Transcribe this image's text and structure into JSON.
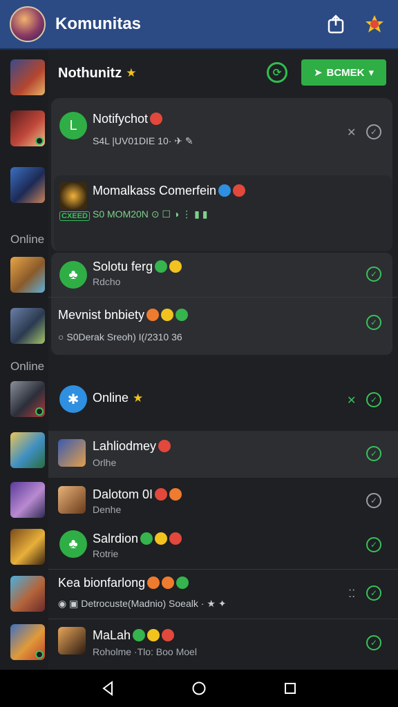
{
  "header": {
    "title": "Komunitas"
  },
  "topbar": {
    "title": "Nothunitz",
    "button_label": "BCMEK"
  },
  "rail_labels": [
    "Online",
    "Online"
  ],
  "rows": [
    {
      "title": "Notifychot",
      "meta": "S4L |UV01DIE  10·"
    },
    {
      "title": "Momalkass Comerfein",
      "badge": "CXEED",
      "meta": "S0 MOM20N"
    },
    {
      "title": "Solotu ferg",
      "sub": "Rdcho"
    },
    {
      "title": "Mevnist bnbiety",
      "meta": "S0Derak Sreoh)  I(/2310  36"
    },
    {
      "title": "Online"
    },
    {
      "title": "Lahliodmey",
      "sub": "Orlhe"
    },
    {
      "title": "Dalotom 0I",
      "sub": "Denhe"
    },
    {
      "title": "Salrdion",
      "sub": "Rotrie"
    },
    {
      "title": "Kea bionfarlong",
      "meta": "Detrocuste(Madnio) Soealk"
    },
    {
      "title": "MaLah",
      "sub": "Roholme ·Tlo: Boo Moel"
    }
  ],
  "icons": [
    "search-icon",
    "home-icon",
    "back-icon",
    "recents-icon"
  ],
  "colors": {
    "header_bg": "#2c4a84",
    "accent_green": "#2fae45",
    "bg": "#1e2023"
  }
}
